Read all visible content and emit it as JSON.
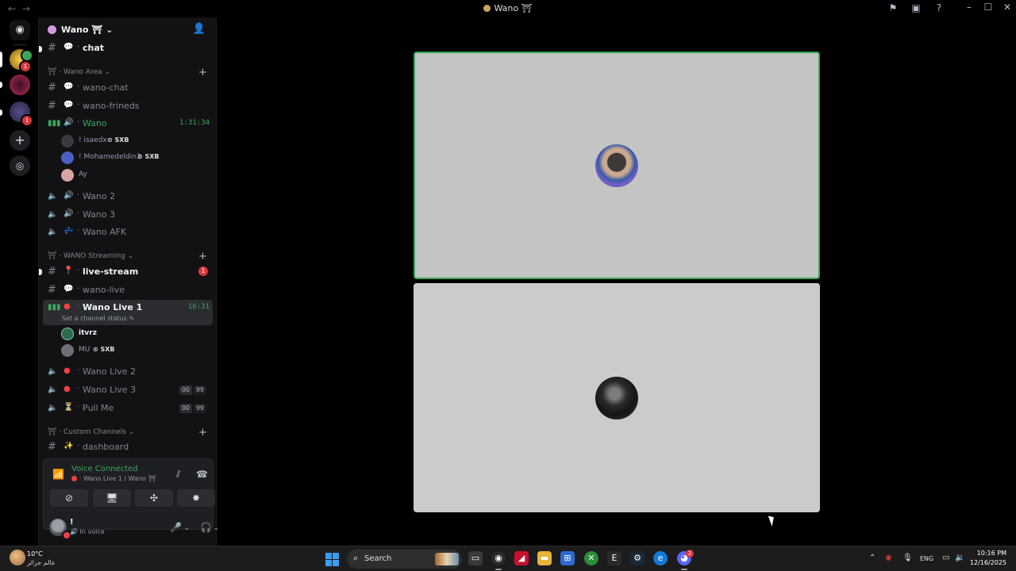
{
  "window": {
    "title": "Wano ⛩",
    "back_icon": "arrow-left-icon",
    "forward_icon": "arrow-right-icon"
  },
  "server_header": {
    "name": "Wano ⛩",
    "chevron": "chevron-down-icon",
    "invite_icon": "add-member-icon"
  },
  "rail": {
    "badges": [
      "1",
      "1"
    ]
  },
  "channels": {
    "top": {
      "name": "chat",
      "glyph": "💬"
    },
    "cat1": {
      "label": "Wano Area",
      "items": [
        {
          "name": "wano-chat"
        },
        {
          "name": "wano-frineds"
        }
      ]
    },
    "voice_wano": {
      "name": "Wano",
      "timer": "1:31:34"
    },
    "voice_users1": [
      {
        "name": "! isaedx",
        "tag": "SXB"
      },
      {
        "name": "! Mohamedeldin3",
        "tag": "SXB"
      },
      {
        "name": "Ay"
      }
    ],
    "voice_more": [
      {
        "name": "Wano 2"
      },
      {
        "name": "Wano 3"
      },
      {
        "name": "Wano AFK"
      }
    ],
    "cat2": {
      "label": "WANO Streaming"
    },
    "live_stream": {
      "name": "live-stream",
      "unread": "1"
    },
    "wano_live": {
      "name": "wano-live"
    },
    "live1": {
      "name": "Wano Live 1",
      "timer": "16:31",
      "status": "Set a channel status"
    },
    "voice_users2": [
      {
        "name": "itvrz"
      },
      {
        "name": "MU",
        "tag": "SXB"
      }
    ],
    "live2": {
      "name": "Wano Live 2"
    },
    "live3": {
      "name": "Wano Live 3",
      "count": "00",
      "limit": "99"
    },
    "pull": {
      "name": "Pull Me",
      "count": "00",
      "limit": "99"
    },
    "cat3": {
      "label": "Custom Channels"
    },
    "dashboard": {
      "name": "dashboard"
    }
  },
  "voice_panel": {
    "title": "Voice Connected",
    "subtitle": "Wano Live 1 / Wano ⛩"
  },
  "user_panel": {
    "name": "!",
    "status": "In voice"
  },
  "taskbar": {
    "temp": "10°C",
    "location": "عالم جزائر",
    "search": "Search",
    "lang": "ENG",
    "time": "10:16 PM",
    "date": "12/16/2025",
    "discord_badge": "2"
  },
  "colors": {
    "speaking_border": "#3ba55c",
    "connected_green": "#3ba55c",
    "unread_red": "#da373c"
  }
}
